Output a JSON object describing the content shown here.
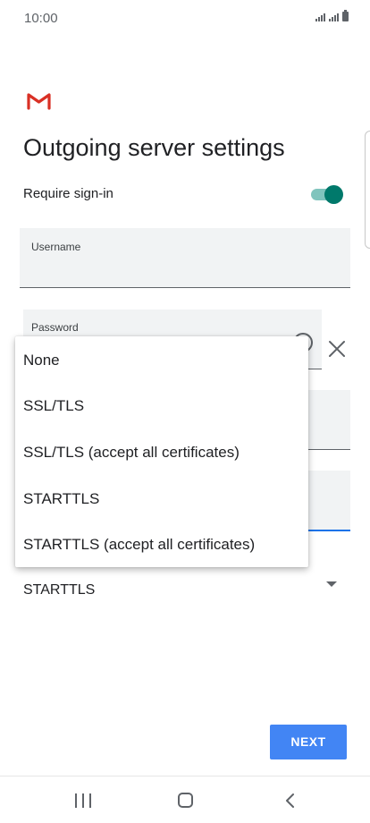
{
  "status_bar": {
    "time": "10:00",
    "icons": [
      "signal-icon",
      "signal-icon",
      "battery-icon"
    ]
  },
  "brand": {
    "logo_icon": "gmail-logo",
    "color": "#d93025"
  },
  "page": {
    "title": "Outgoing server settings"
  },
  "require_signin": {
    "label": "Require sign-in",
    "enabled": true,
    "accent": "#00796b"
  },
  "fields": {
    "username": {
      "label": "Username",
      "value": ""
    },
    "password": {
      "label": "Password",
      "value": ""
    },
    "server": {
      "label": "",
      "value": ""
    },
    "port": {
      "label": "",
      "value": ""
    }
  },
  "security": {
    "selected": "STARTTLS",
    "options": [
      "None",
      "SSL/TLS",
      "SSL/TLS (accept all certificates)",
      "STARTTLS",
      "STARTTLS (accept all certificates)"
    ]
  },
  "buttons": {
    "next": "NEXT",
    "next_color": "#4285f4"
  },
  "nav": {
    "recents_icon": "recents-icon",
    "home_icon": "home-icon",
    "back_icon": "back-icon"
  }
}
